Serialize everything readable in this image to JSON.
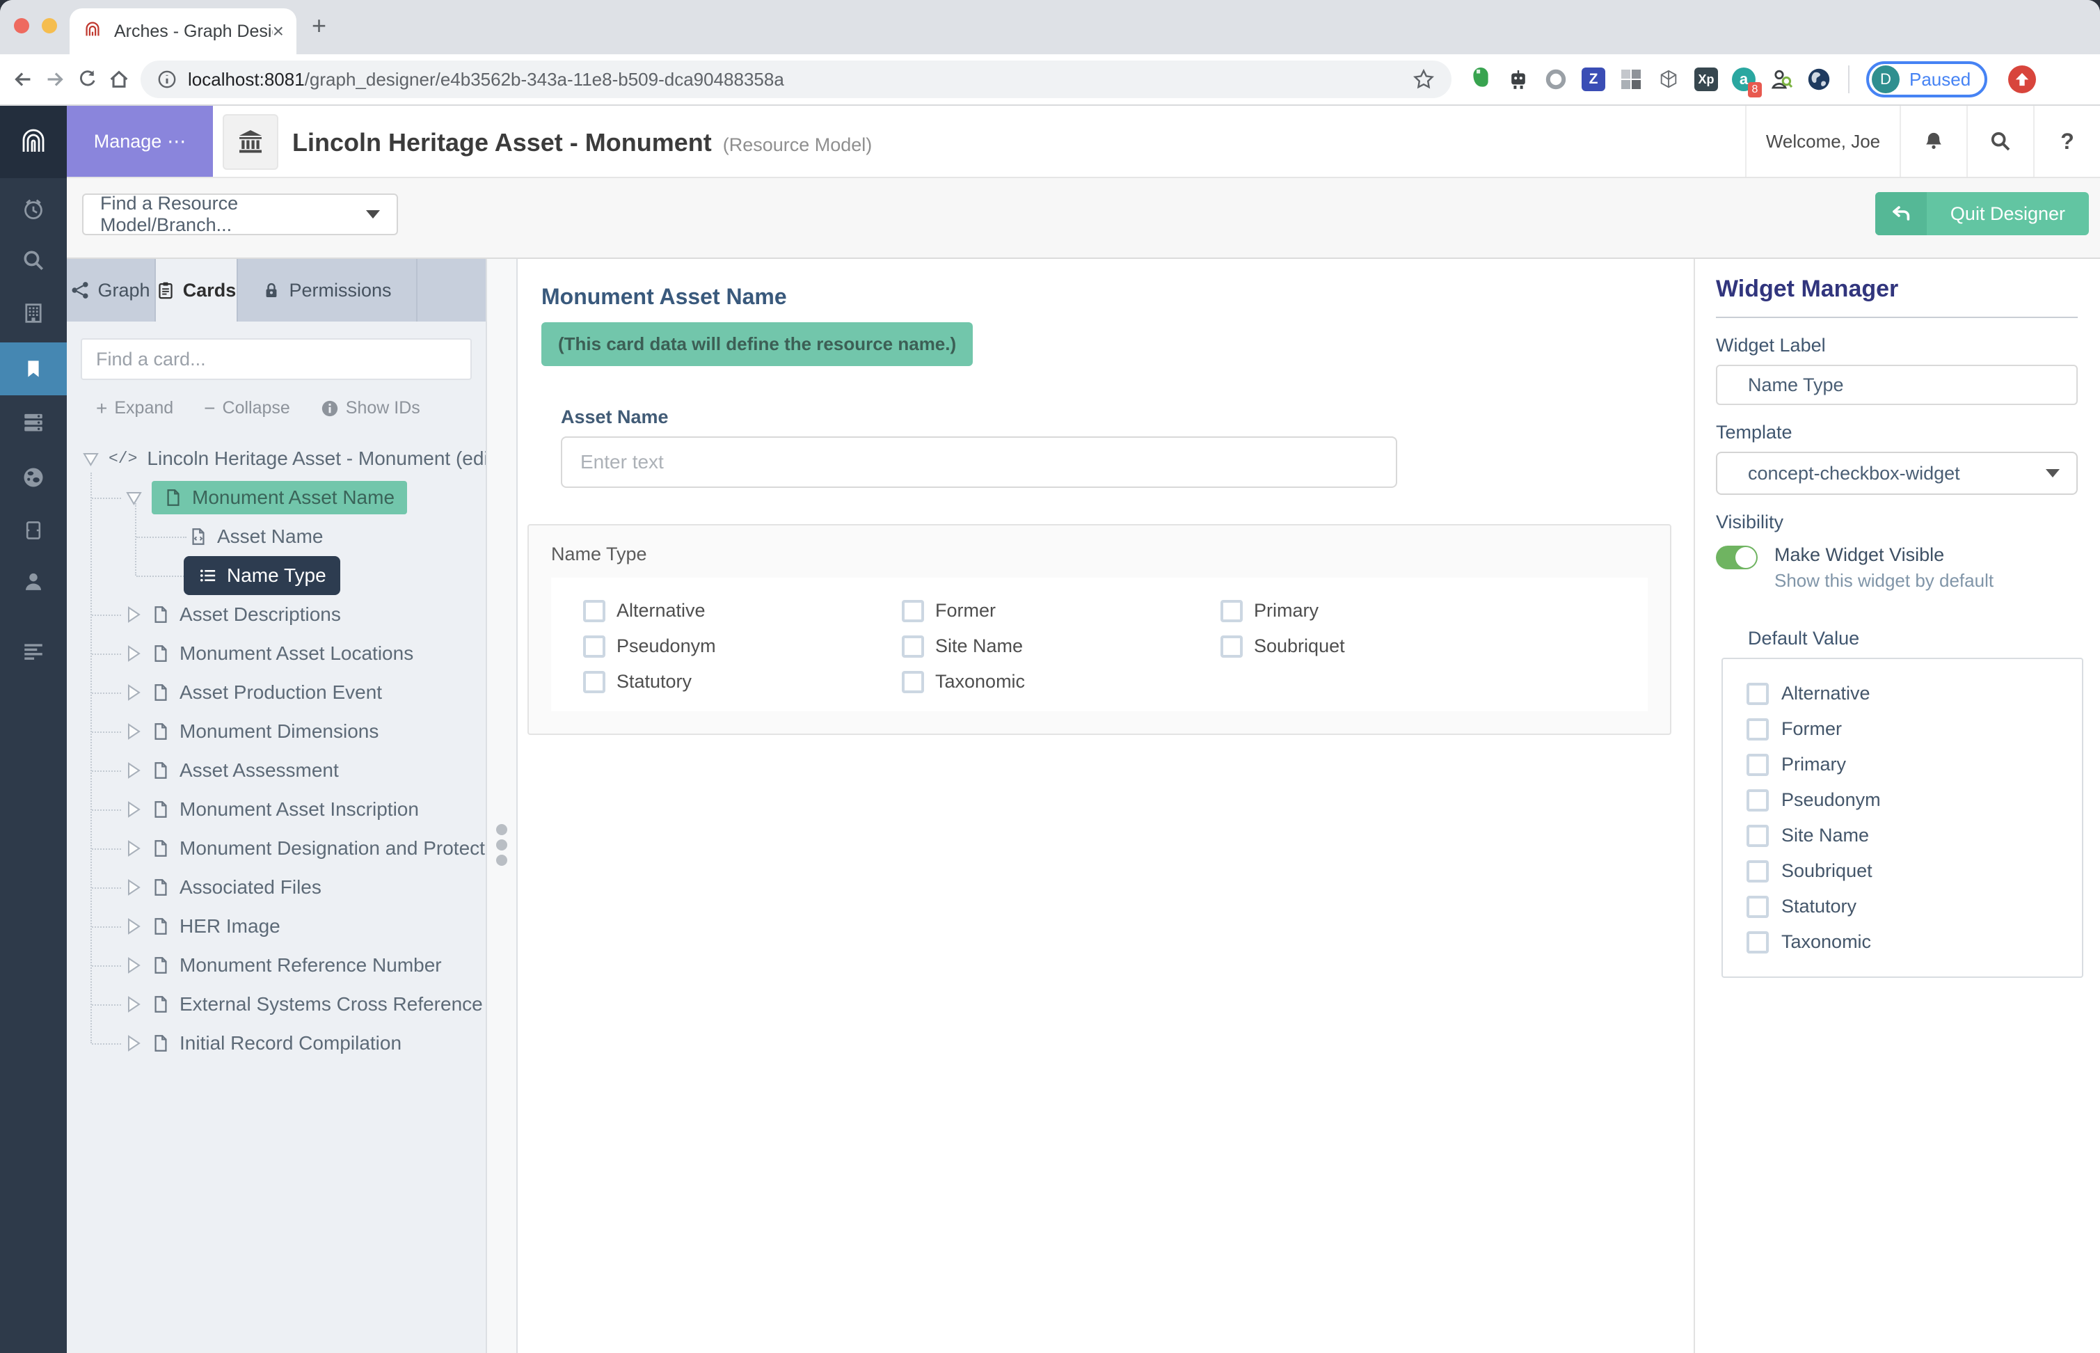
{
  "browser": {
    "tab_title": "Arches - Graph Designer",
    "new_tab_symbol": "+",
    "close_symbol": "×",
    "url_host": "localhost:8081",
    "url_path": "/graph_designer/e4b3562b-343a-11e8-b509-dca90488358a",
    "extensions": {
      "zotero_letter": "Z",
      "xp_label": "Xp",
      "a_letter": "a",
      "a_badge": "8"
    },
    "paused_avatar": "D",
    "paused_label": "Paused"
  },
  "header": {
    "manage_label": "Manage",
    "manage_more": "⋯",
    "title": "Lincoln Heritage Asset - Monument",
    "subtitle": "(Resource Model)",
    "welcome": "Welcome, Joe",
    "help_symbol": "?"
  },
  "toolbar": {
    "find_model_placeholder": "Find a Resource Model/Branch...",
    "quit_label": "Quit Designer"
  },
  "tabs": [
    {
      "label": "Graph"
    },
    {
      "label": "Cards"
    },
    {
      "label": "Permissions"
    }
  ],
  "cards_panel": {
    "search_placeholder": "Find a card...",
    "expand_symbol": "+",
    "expand_label": "Expand",
    "collapse_symbol": "−",
    "collapse_label": "Collapse",
    "show_ids_label": "Show IDs",
    "code_icon": "</>",
    "tree": [
      {
        "label": "Lincoln Heritage Asset - Monument (edit r"
      },
      {
        "label": "Monument Asset Name"
      },
      {
        "label": "Asset Name"
      },
      {
        "label": "Name Type"
      },
      {
        "label": "Asset Descriptions"
      },
      {
        "label": "Monument Asset Locations"
      },
      {
        "label": "Asset Production Event"
      },
      {
        "label": "Monument Dimensions"
      },
      {
        "label": "Asset Assessment"
      },
      {
        "label": "Monument Asset Inscription"
      },
      {
        "label": "Monument Designation and Protectio"
      },
      {
        "label": "Associated Files"
      },
      {
        "label": "HER Image"
      },
      {
        "label": "Monument Reference Number"
      },
      {
        "label": "External Systems Cross Reference"
      },
      {
        "label": "Initial Record Compilation"
      }
    ]
  },
  "card_editor": {
    "title": "Monument Asset Name",
    "notice": "(This card data will define the resource name.)",
    "asset_name_label": "Asset Name",
    "asset_name_placeholder": "Enter text",
    "name_type_label": "Name Type",
    "checkboxes": [
      "Alternative",
      "Former",
      "Primary",
      "Pseudonym",
      "Site Name",
      "Soubriquet",
      "Statutory",
      "Taxonomic"
    ]
  },
  "widget_manager": {
    "title": "Widget Manager",
    "widget_label_label": "Widget Label",
    "widget_label_value": "Name Type",
    "template_label": "Template",
    "template_value": "concept-checkbox-widget",
    "visibility_label": "Visibility",
    "visible_label": "Make Widget Visible",
    "visible_sub": "Show this widget by default",
    "default_value_label": "Default Value",
    "default_options": [
      "Alternative",
      "Former",
      "Primary",
      "Pseudonym",
      "Site Name",
      "Soubriquet",
      "Statutory",
      "Taxonomic"
    ]
  },
  "colors": {
    "sidebar": "#2e3a4a",
    "sidebar_active": "#4587b2",
    "manage_purple": "#8a85dc",
    "accent_teal": "#72c6ab",
    "quit_green": "#62c5a2",
    "selected_navy": "#2d3c50",
    "toggle_green": "#6fb461",
    "heading_indigo": "#31357d",
    "heading_slate": "#39597c"
  }
}
